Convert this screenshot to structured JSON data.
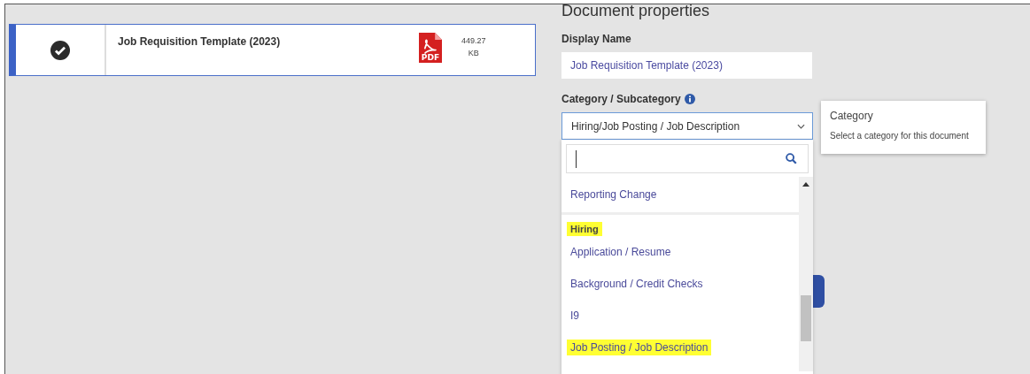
{
  "file_row": {
    "selected": true,
    "name": "Job Requisition Template (2023)",
    "size": "449.27",
    "size_unit": "KB",
    "file_type": "PDF"
  },
  "properties": {
    "heading": "Document properties",
    "display_name_label": "Display Name",
    "display_name_value": "Job Requisition Template (2023)",
    "category_label": "Category / Subcategory",
    "category_value": "Hiring/Job Posting / Job Description"
  },
  "tooltip": {
    "title": "Category",
    "text": "Select a category for this document"
  },
  "dropdown": {
    "items": [
      {
        "kind": "option",
        "label": "Reporting Change",
        "highlighted": false,
        "last_in_group": true
      },
      {
        "kind": "group",
        "label": "Hiring",
        "highlighted": true
      },
      {
        "kind": "option",
        "label": "Application / Resume",
        "highlighted": false,
        "last_in_group": false
      },
      {
        "kind": "option",
        "label": "Background / Credit Checks",
        "highlighted": false,
        "last_in_group": false
      },
      {
        "kind": "option",
        "label": "I9",
        "highlighted": false,
        "last_in_group": false
      },
      {
        "kind": "option",
        "label": "Job Posting / Job Description",
        "highlighted": true,
        "last_in_group": false
      }
    ]
  }
}
